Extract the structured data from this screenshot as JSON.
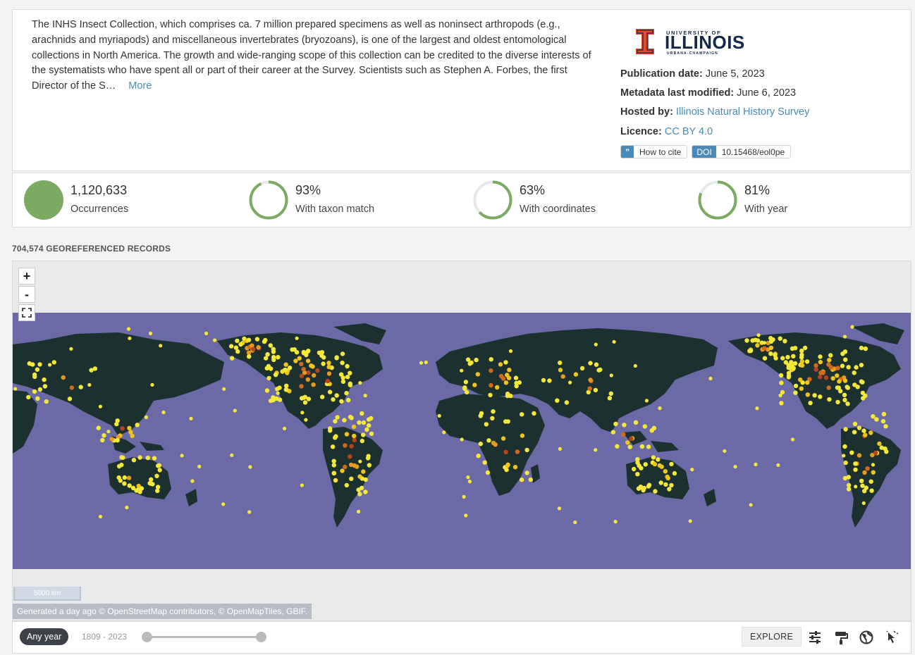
{
  "dataset": {
    "description": "The INHS Insect Collection, which comprises ca. 7 million prepared specimens as well as noninsect arthropods (e.g., arachnids and myriapods) and miscellaneous invertebrates (bryozoans), is one of the largest and oldest entomological collections in North America. The growth and wide-ranging scope of this collection can be credited to the diverse interests of the systematists who have spent all or part of their career at the Survey. Scientists such as Stephen A. Forbes, the first Director of the S…",
    "more_label": "More"
  },
  "logo": {
    "small_text": "UNIVERSITY OF",
    "big_text": "ILLINOIS",
    "tiny_text": "URBANA-CHAMPAIGN"
  },
  "meta": {
    "publication_label": "Publication date:",
    "publication_value": "June 5, 2023",
    "modified_label": "Metadata last modified:",
    "modified_value": "June 6, 2023",
    "hosted_label": "Hosted by:",
    "hosted_value": "Illinois Natural History Survey",
    "licence_label": "Licence:",
    "licence_value": "CC BY 4.0",
    "cite_label": "How to cite",
    "doi_label": "DOI",
    "doi_value": "10.15468/eol0pe"
  },
  "stats": [
    {
      "value": "1,120,633",
      "label": "Occurrences",
      "fraction": 1.0
    },
    {
      "value": "93%",
      "label": "With taxon match",
      "fraction": 0.93
    },
    {
      "value": "63%",
      "label": "With coordinates",
      "fraction": 0.63
    },
    {
      "value": "81%",
      "label": "With year",
      "fraction": 0.81
    }
  ],
  "geo_heading": "704,574 GEOREFERENCED RECORDS",
  "map": {
    "zoom_in": "+",
    "zoom_out": "-",
    "fullscreen": "⛶",
    "scale": "5000 km",
    "attribution": "Generated a day ago © OpenStreetMap contributors, © OpenMapTiles, GBIF.",
    "ocean_color": "#6b6aa6",
    "land_color": "#1c3030"
  },
  "toolbar": {
    "any_year": "Any year",
    "year_range": "1809 - 2023",
    "explore": "EXPLORE"
  },
  "colors": {
    "accent": "#7caa63",
    "link": "#4a8ab8",
    "ring_track": "#e6e9ea"
  }
}
